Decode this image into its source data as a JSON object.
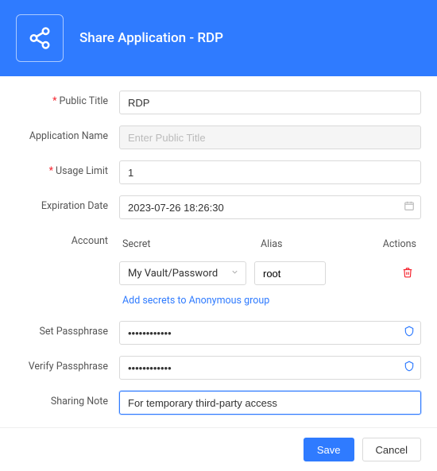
{
  "header": {
    "title": "Share Application - RDP"
  },
  "form": {
    "public_title": {
      "label": "Public Title",
      "required": true,
      "value": "RDP"
    },
    "application_name": {
      "label": "Application Name",
      "required": false,
      "placeholder": "Enter Public Title",
      "value": ""
    },
    "usage_limit": {
      "label": "Usage Limit",
      "required": true,
      "value": "1"
    },
    "expiration_date": {
      "label": "Expiration Date",
      "required": false,
      "value": "2023-07-26 18:26:30"
    },
    "account": {
      "label": "Account",
      "columns": {
        "secret": "Secret",
        "alias": "Alias",
        "actions": "Actions"
      },
      "rows": [
        {
          "secret": "My Vault/Password",
          "alias": "root"
        }
      ],
      "add_link": "Add secrets to Anonymous group"
    },
    "set_passphrase": {
      "label": "Set Passphrase",
      "value": "••••••••••••"
    },
    "verify_passphrase": {
      "label": "Verify Passphrase",
      "value": "••••••••••••"
    },
    "sharing_note": {
      "label": "Sharing Note",
      "value": "For temporary third-party access"
    }
  },
  "footer": {
    "save": "Save",
    "cancel": "Cancel"
  }
}
